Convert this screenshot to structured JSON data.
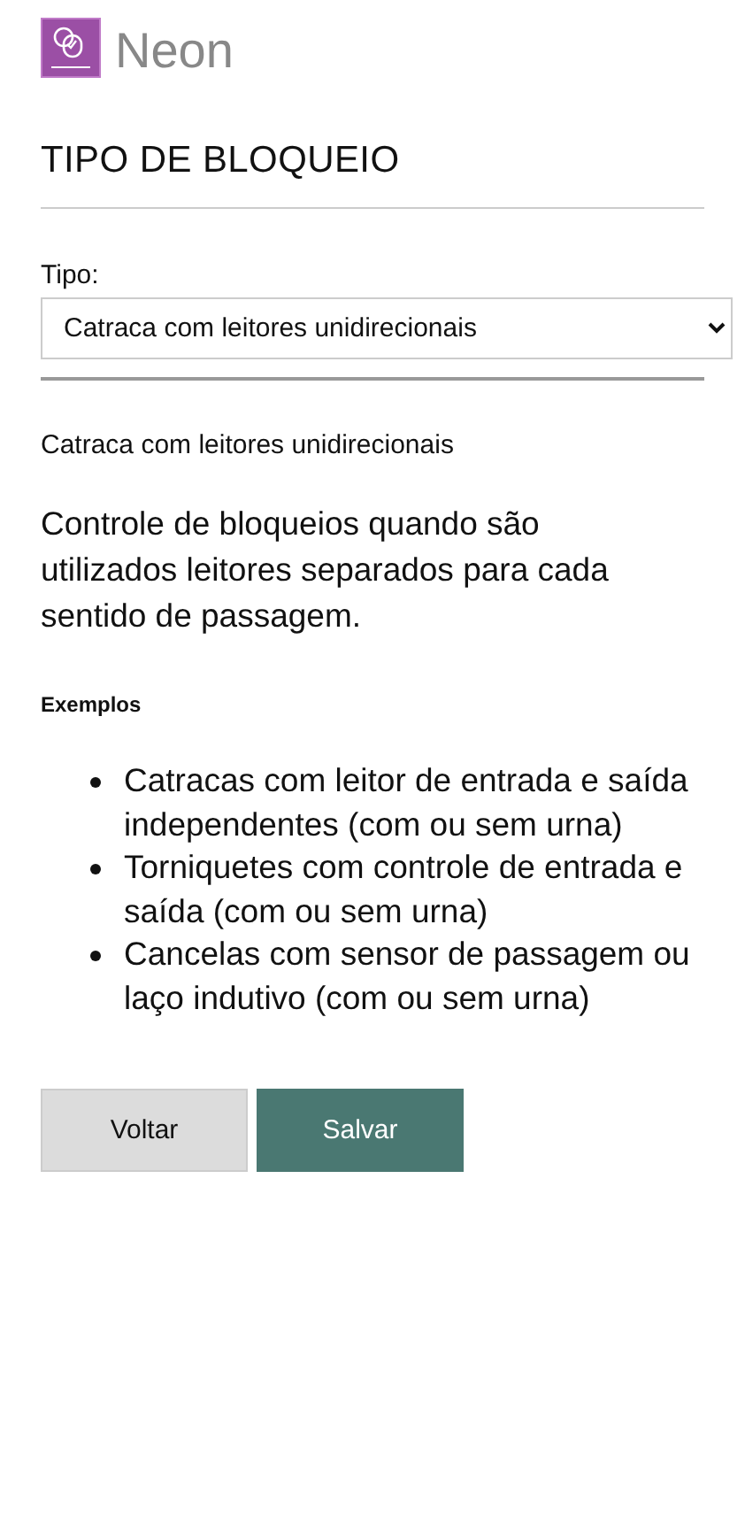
{
  "brand": {
    "name": "Neon"
  },
  "heading": "TIPO DE BLOQUEIO",
  "type_field": {
    "label": "Tipo:",
    "value": "Catraca com leitores unidirecionais"
  },
  "subtitle": "Catraca com leitores unidirecionais",
  "description": "Controle de bloqueios quando são utilizados leitores separados para cada sentido de passagem.",
  "examples_label": "Exemplos",
  "examples": [
    "Catracas com leitor de entrada e saída independentes (com ou sem urna)",
    "Torniquetes com controle de entrada e saída (com ou sem urna)",
    "Cancelas com sensor de passagem ou laço indutivo (com ou sem urna)"
  ],
  "buttons": [
    {
      "label": "Voltar",
      "kind": "secondary"
    },
    {
      "label": "Salvar",
      "kind": "primary"
    }
  ]
}
